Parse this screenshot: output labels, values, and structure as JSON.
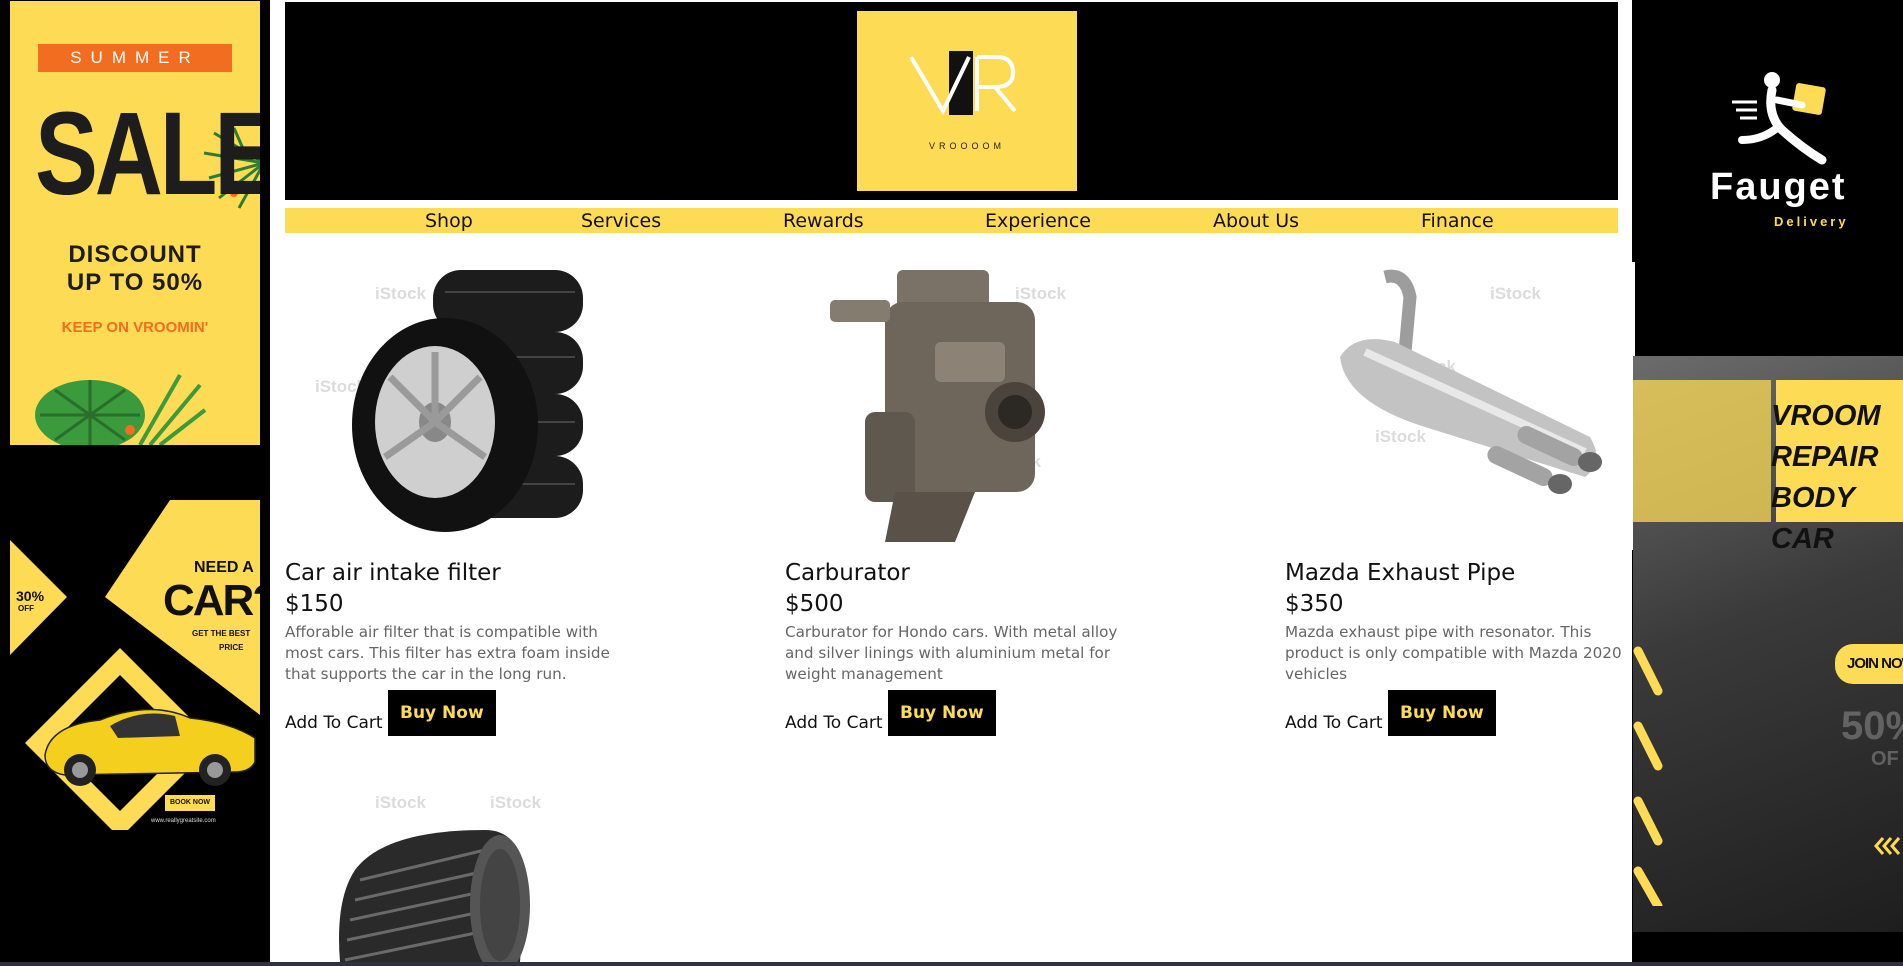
{
  "left_ads": {
    "summer": {
      "tag": "SUMMER",
      "sale": "SALE",
      "discount_line1": "DISCOUNT",
      "discount_line2": "UP TO 50%",
      "tagline": "KEEP ON VROOMIN'"
    },
    "car": {
      "badge_pct": "30%",
      "badge_off": "OFF",
      "need_a": "NEED A",
      "car": "CAR?",
      "best_price_1": "GET THE BEST",
      "best_price_2": "PRICE",
      "book_now": "BOOK NOW",
      "website": "www.reallygreatsite.com"
    }
  },
  "header": {
    "logo_mark": "VR",
    "logo_brand": "VROOOOM"
  },
  "nav": {
    "items": [
      "Shop",
      "Services",
      "Rewards",
      "Experience",
      "About Us",
      "Finance"
    ]
  },
  "watermark": "iStock",
  "products": [
    {
      "name": "Car air intake filter",
      "price": "$150",
      "description": "Afforable air filter that is compatible with most cars. This filter has extra foam inside that supports the car in the long run.",
      "add_to_cart": "Add To Cart",
      "buy_now": "Buy Now"
    },
    {
      "name": "Carburator",
      "price": "$500",
      "description": "Carburator for Hondo cars. With metal alloy and silver linings with aluminium metal for weight management",
      "add_to_cart": "Add To Cart",
      "buy_now": "Buy Now"
    },
    {
      "name": "Mazda Exhaust Pipe",
      "price": "$350",
      "description": "Mazda exhaust pipe with resonator. This product is only compatible with Mazda 2020 vehicles",
      "add_to_cart": "Add To Cart",
      "buy_now": "Buy Now"
    }
  ],
  "right_ads": {
    "fauget": {
      "name": "Fauget",
      "sub": "Delivery"
    },
    "repair": {
      "line1": "VROOM",
      "line2": "REPAIR",
      "line3": "BODY CAR",
      "join": "JOIN NOW",
      "pct": "50%",
      "off": "OF"
    }
  },
  "colors": {
    "accent": "#fedb55",
    "black": "#000000",
    "orange": "#f26d1f"
  }
}
